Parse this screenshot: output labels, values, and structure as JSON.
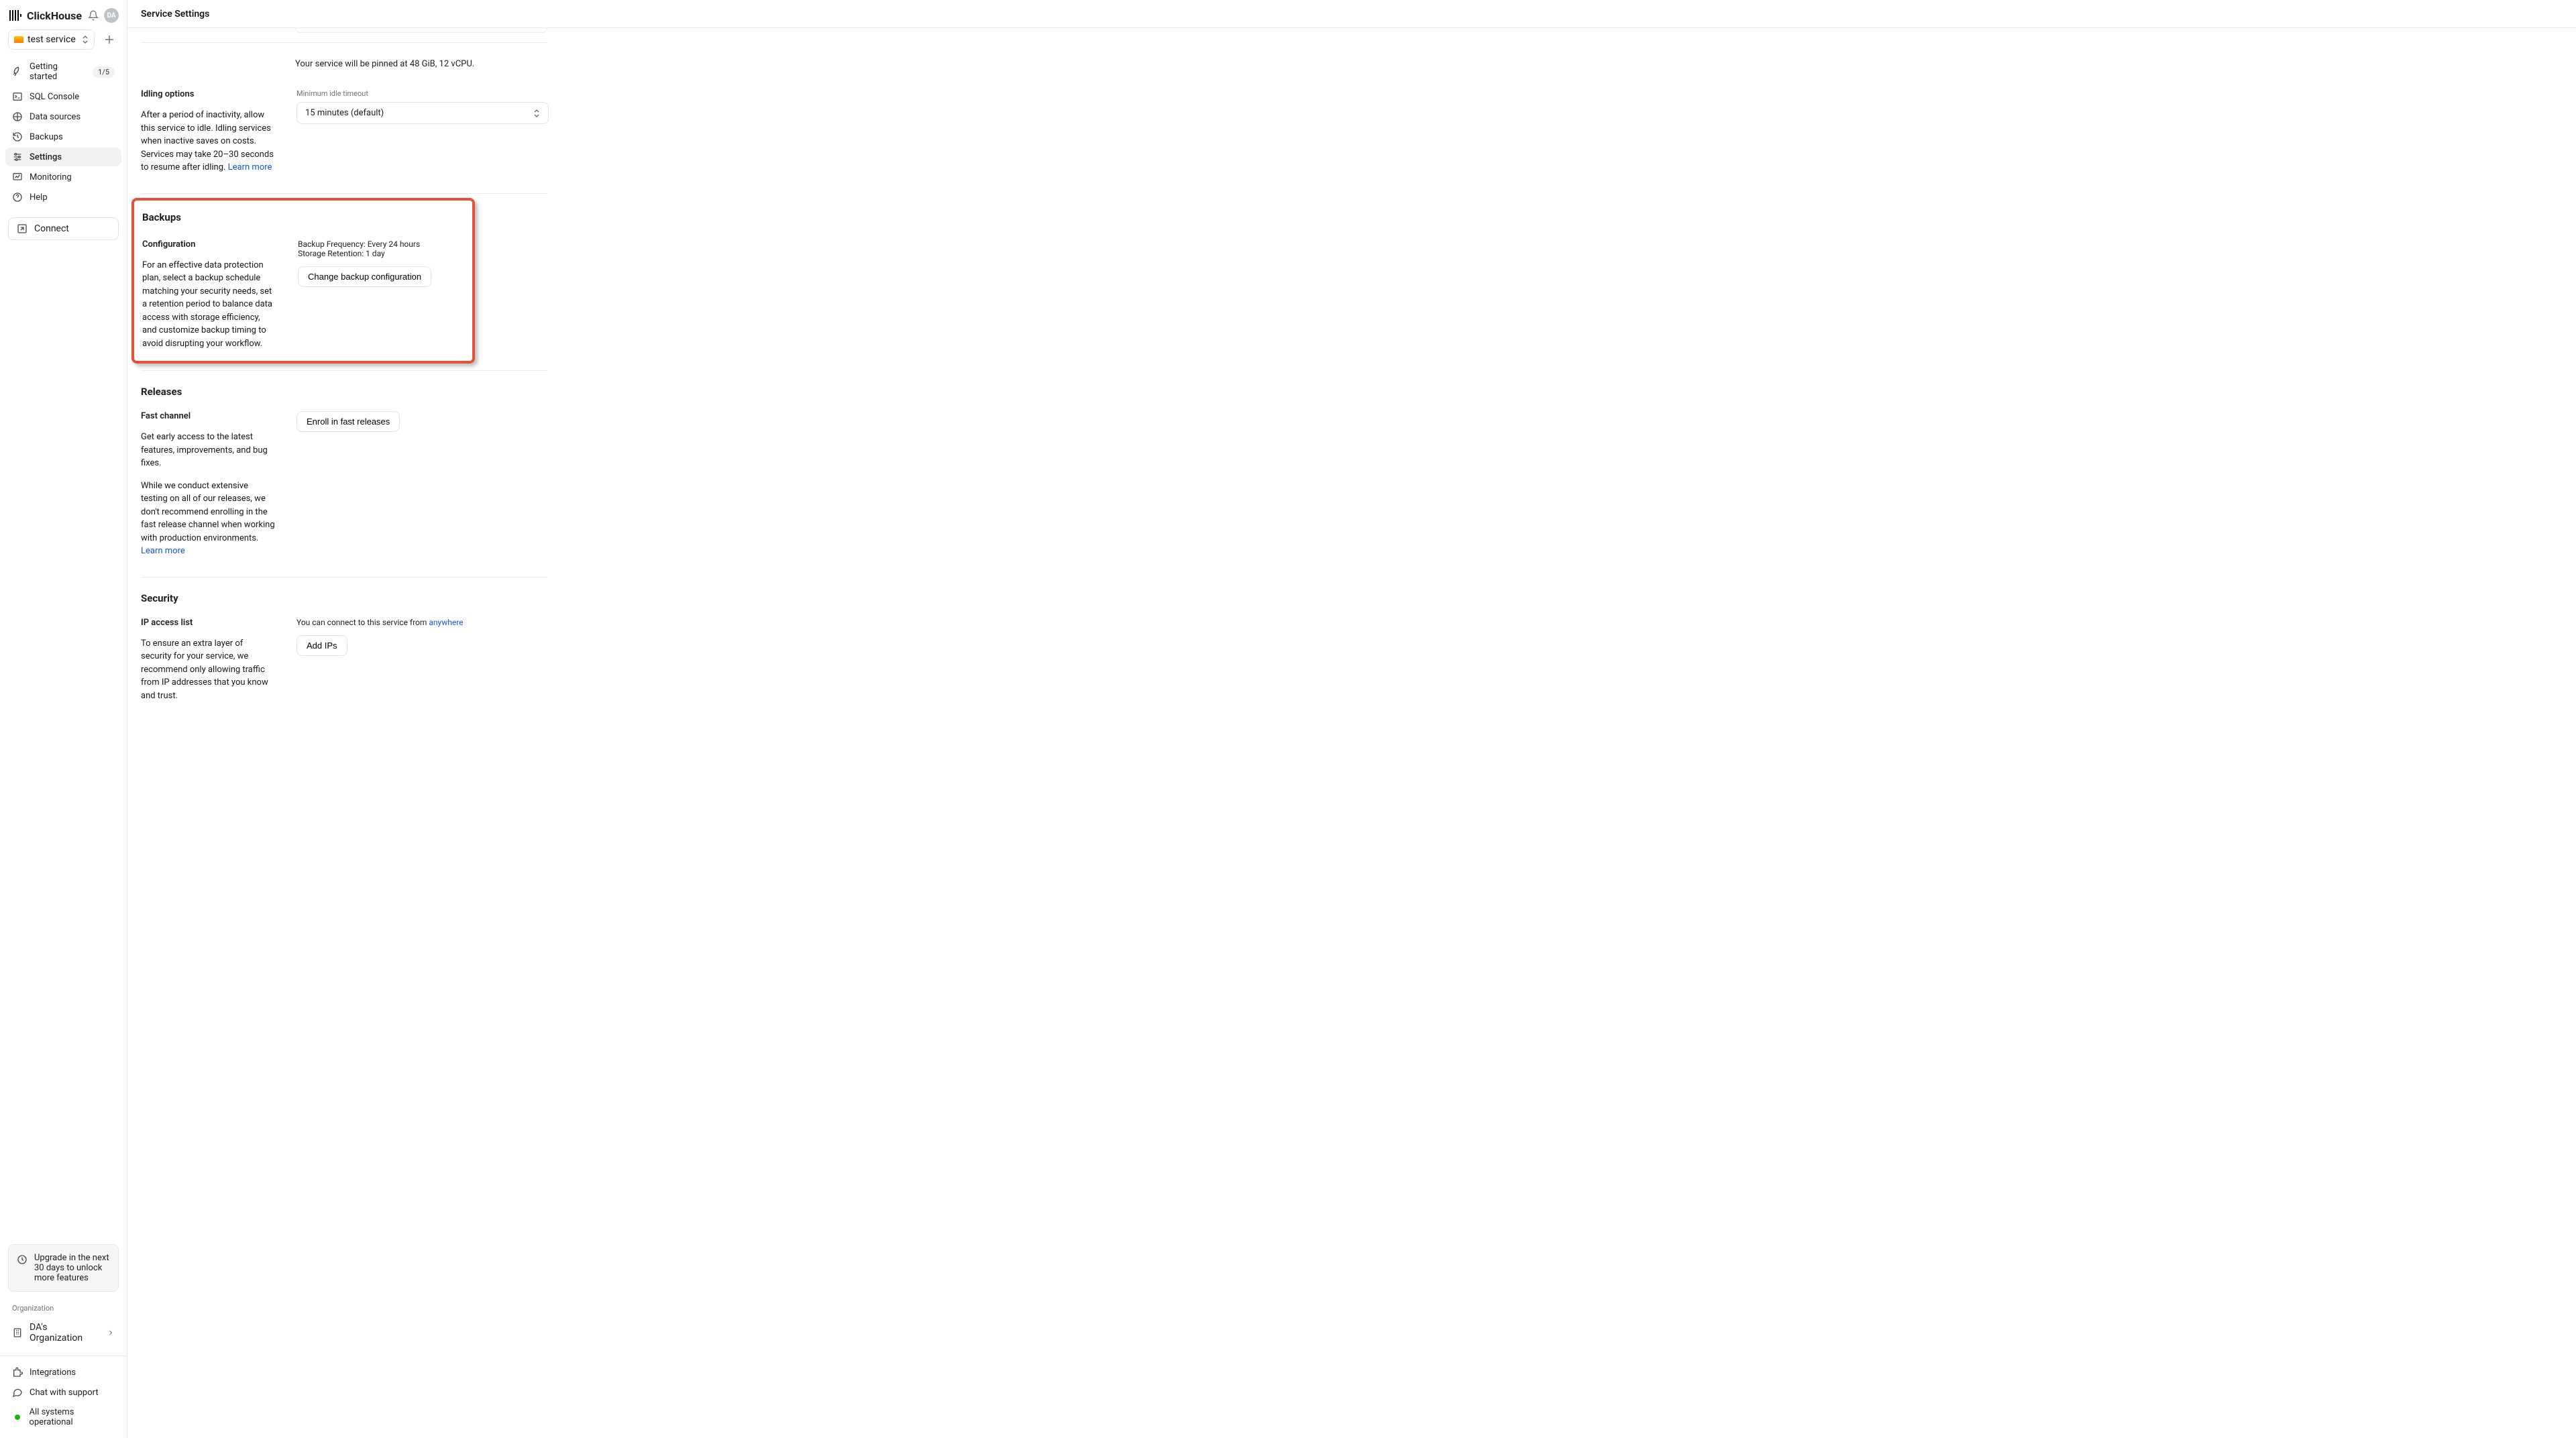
{
  "brand": {
    "name": "ClickHouse",
    "avatar_initials": "DA"
  },
  "service_selector": {
    "name": "test service"
  },
  "nav": {
    "getting_started": "Getting started",
    "getting_started_badge": "1/5",
    "sql_console": "SQL Console",
    "data_sources": "Data sources",
    "backups": "Backups",
    "settings": "Settings",
    "monitoring": "Monitoring",
    "help": "Help",
    "connect": "Connect"
  },
  "upgrade_text": "Upgrade in the next 30 days to unlock more features",
  "org": {
    "label": "Organization",
    "name": "DA's Organization"
  },
  "footer": {
    "integrations": "Integrations",
    "chat": "Chat with support",
    "status": "All systems operational"
  },
  "page": {
    "title": "Service Settings"
  },
  "pinned_line": "Your service will be pinned at 48 GiB, 12 vCPU.",
  "idling": {
    "heading": "Idling options",
    "description": "After a period of inactivity, allow this service to idle. Idling services when inactive saves on costs. Services may take 20–30 seconds to resume after idling. ",
    "learn_more": "Learn more",
    "min_label": "Minimum idle timeout",
    "select_value": "15 minutes (default)"
  },
  "backups": {
    "title": "Backups",
    "sub": "Configuration",
    "desc": "For an effective data protection plan, select a backup schedule matching your security needs, set a retention period to balance data access with storage efficiency, and customize backup timing to avoid disrupting your workflow.",
    "freq_line": "Backup Frequency: Every 24 hours",
    "retention_line": "Storage Retention: 1 day",
    "button": "Change backup configuration"
  },
  "releases": {
    "title": "Releases",
    "sub": "Fast channel",
    "p1": "Get early access to the latest features, improvements, and bug fixes.",
    "p2": "While we conduct extensive testing on all of our releases, we don't recommend enrolling in the fast release channel when working with production environments. ",
    "learn_more": "Learn more",
    "button": "Enroll in fast releases"
  },
  "security": {
    "title": "Security",
    "sub": "IP access list",
    "desc": "To ensure an extra layer of security for your service, we recommend only allowing traffic from IP addresses that you know and trust.",
    "connect_text": "You can connect to this service from ",
    "anywhere": "anywhere",
    "button": "Add IPs"
  }
}
